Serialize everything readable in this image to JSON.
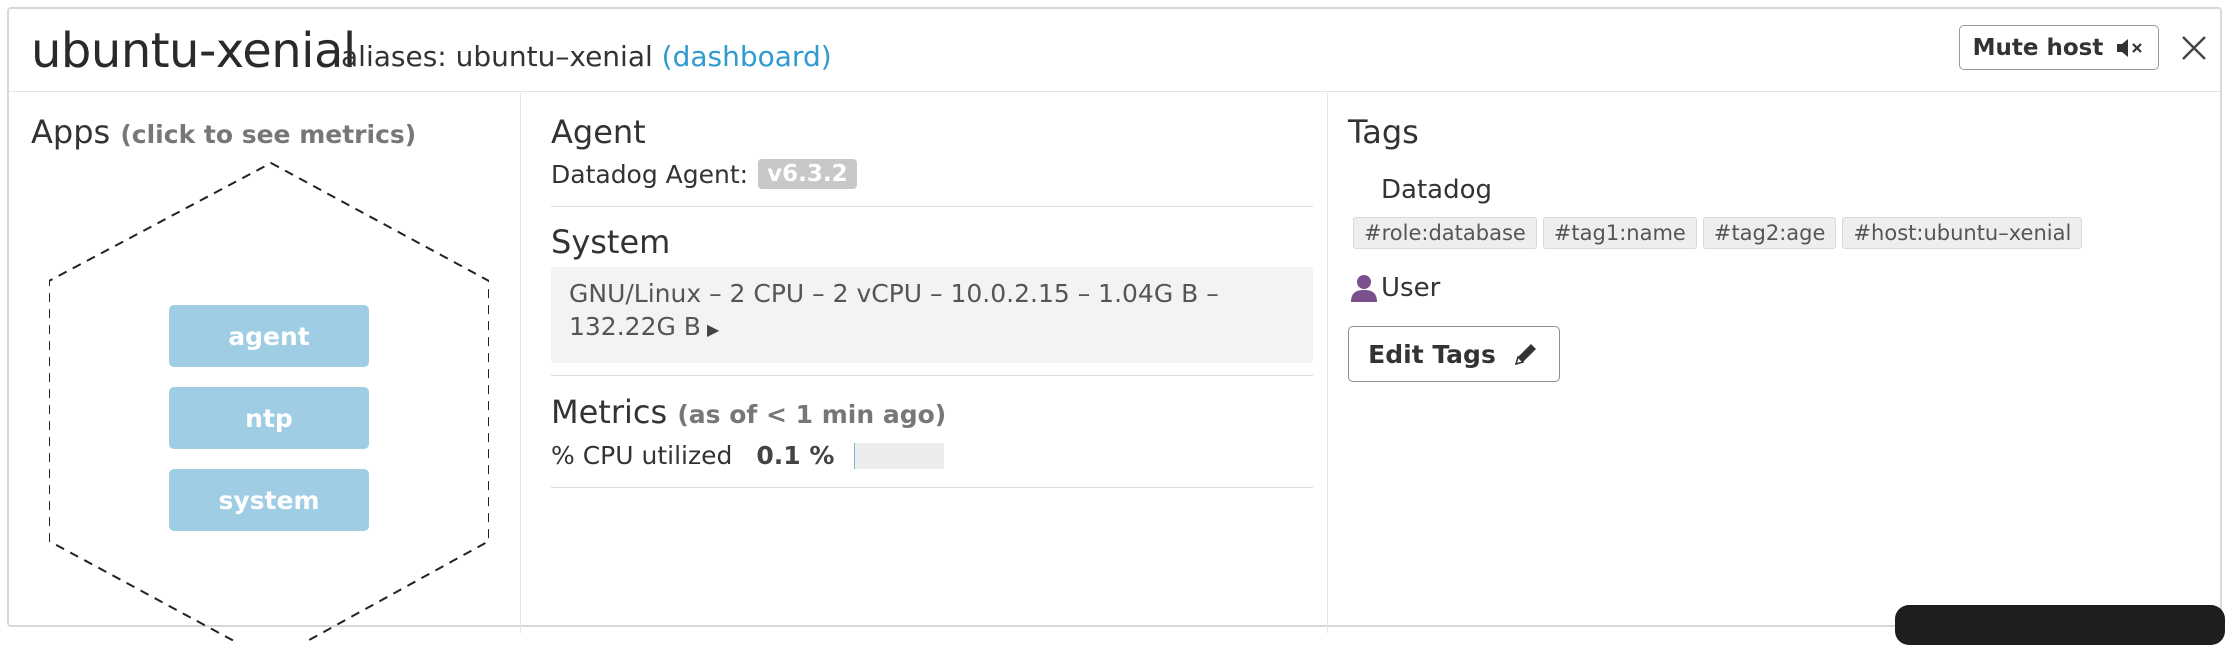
{
  "header": {
    "host_name": "ubuntu-xenial",
    "aliases_label": "aliases:",
    "alias": "ubuntu–xenial",
    "dashboard_link": "(dashboard)",
    "mute_label": "Mute host",
    "mute_icon": "speaker-muted-icon",
    "close_icon": "close-icon"
  },
  "apps": {
    "title": "Apps",
    "subtitle": "(click to see metrics)",
    "items": [
      "agent",
      "ntp",
      "system"
    ],
    "button_color": "#9fcde4"
  },
  "agent": {
    "title": "Agent",
    "label": "Datadog Agent:",
    "version": "v6.3.2"
  },
  "system": {
    "title": "System",
    "details": "GNU/Linux – 2 CPU – 2 vCPU – 10.0.2.15 – 1.04G B – 132.22G B",
    "expand_icon": "caret-right-icon"
  },
  "metrics": {
    "title": "Metrics",
    "subtitle": "(as of < 1 min ago)",
    "cpu_label": "% CPU utilized",
    "cpu_value": "0.1 %",
    "cpu_fraction": 0.001
  },
  "tags": {
    "title": "Tags",
    "source_datadog": "Datadog",
    "datadog_tags": [
      "#role:database",
      "#tag1:name",
      "#tag2:age",
      "#host:ubuntu–xenial"
    ],
    "user_label": "User",
    "user_icon": "user-icon",
    "user_icon_color": "#7b4f8c",
    "edit_label": "Edit Tags",
    "edit_icon": "pencil-icon"
  },
  "colors": {
    "link": "#2f9bd0",
    "badge": "#c8c8c8"
  }
}
